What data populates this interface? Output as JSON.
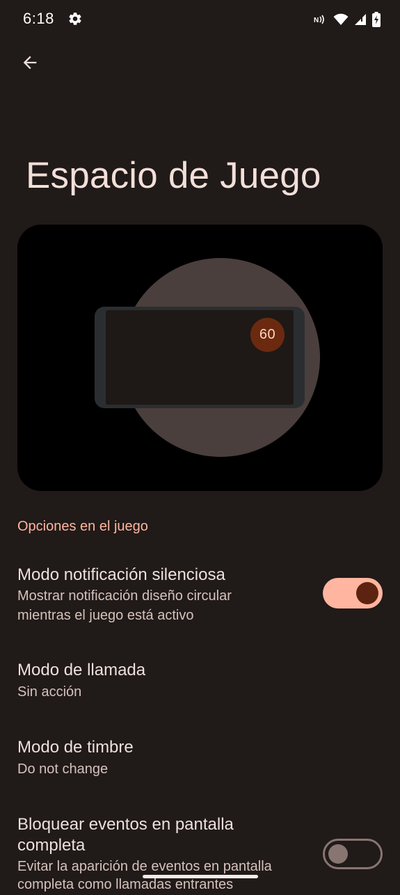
{
  "status_bar": {
    "time": "6:18",
    "icons": [
      "settings-gear-icon",
      "nfc-icon",
      "wifi-icon",
      "cell-signal-icon",
      "battery-charging-icon"
    ]
  },
  "toolbar": {
    "back_icon": "arrow-back-icon"
  },
  "page": {
    "title": "Espacio de Juego"
  },
  "preview": {
    "fps_value": "60"
  },
  "section": {
    "header": "Opciones en el juego"
  },
  "settings": [
    {
      "title": "Modo notificación silenciosa",
      "subtitle_line1": "Mostrar notificación diseño circular",
      "subtitle_line2": "mientras el juego está activo",
      "toggle": true
    },
    {
      "title": "Modo de llamada",
      "subtitle": "Sin acción"
    },
    {
      "title": "Modo de timbre",
      "subtitle": "Do not change"
    },
    {
      "title_line1": "Bloquear eventos en pantalla",
      "title_line2": "completa",
      "subtitle_line1": "Evitar la aparición de eventos en pantalla",
      "subtitle_line2": "completa como llamadas entrantes",
      "toggle": false
    }
  ],
  "colors": {
    "background": "#201a18",
    "accent": "#ffb59f",
    "toggle_knob_on": "#5c2410",
    "toggle_off": "#887571"
  }
}
